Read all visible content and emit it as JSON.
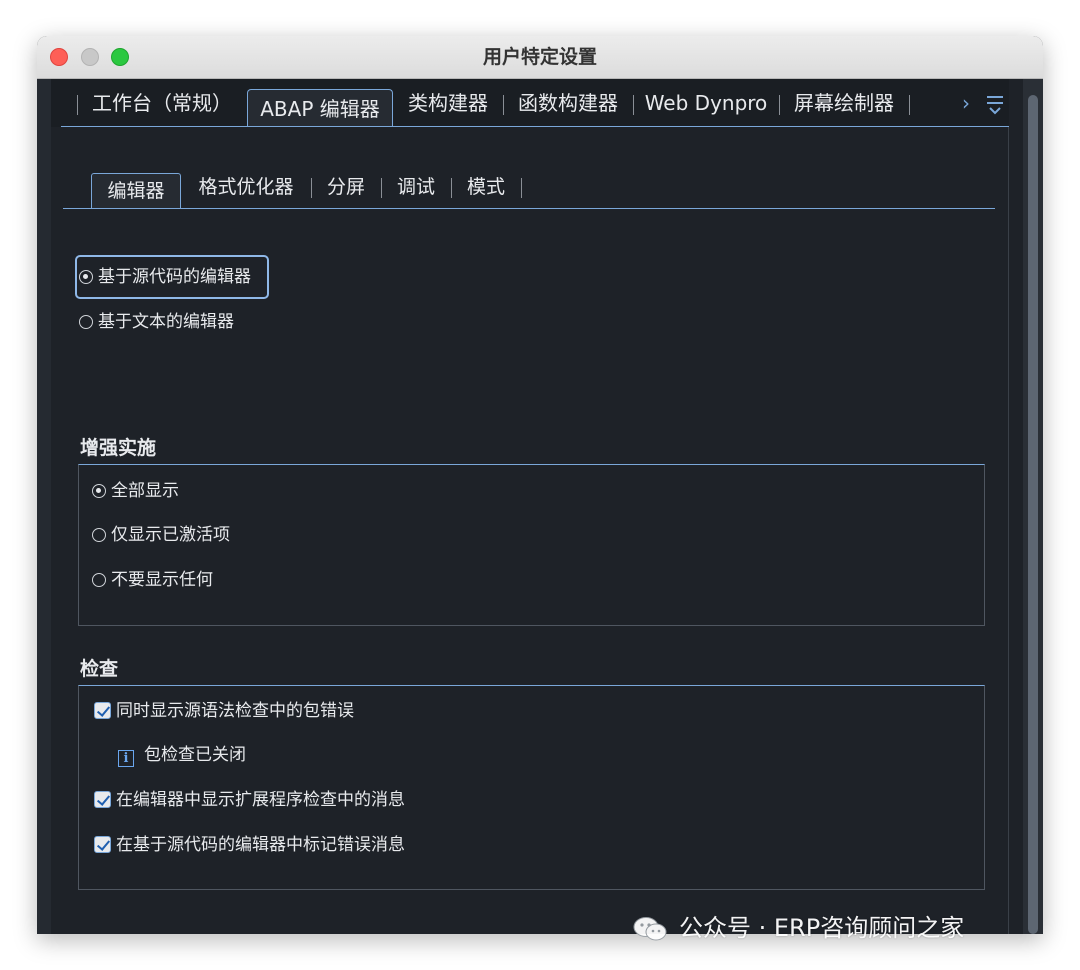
{
  "window": {
    "title": "用户特定设置"
  },
  "main_tabs": [
    {
      "label": "工作台（常规）",
      "active": false
    },
    {
      "label": "ABAP 编辑器",
      "active": true
    },
    {
      "label": "类构建器",
      "active": false
    },
    {
      "label": "函数构建器",
      "active": false
    },
    {
      "label": "Web Dynpro",
      "active": false
    },
    {
      "label": "屏幕绘制器",
      "active": false
    }
  ],
  "tab_nav": {
    "more_icon": "chevron-right-icon",
    "list_icon": "tab-list-icon"
  },
  "sub_tabs": [
    {
      "label": "编辑器",
      "active": true
    },
    {
      "label": "格式优化器",
      "active": false
    },
    {
      "label": "分屏",
      "active": false
    },
    {
      "label": "调试",
      "active": false
    },
    {
      "label": "模式",
      "active": false
    }
  ],
  "editor_type": {
    "options": [
      {
        "label": "基于源代码的编辑器",
        "selected": true
      },
      {
        "label": "基于文本的编辑器",
        "selected": false
      }
    ]
  },
  "enhancement": {
    "title": "增强实施",
    "options": [
      {
        "label": "全部显示",
        "selected": true
      },
      {
        "label": "仅显示已激活项",
        "selected": false
      },
      {
        "label": "不要显示任何",
        "selected": false
      }
    ]
  },
  "checks": {
    "title": "检查",
    "items": [
      {
        "label": "同时显示源语法检查中的包错误",
        "checked": true
      },
      {
        "label": "在编辑器中显示扩展程序检查中的消息",
        "checked": true
      },
      {
        "label": "在基于源代码的编辑器中标记错误消息",
        "checked": true
      }
    ],
    "info": "包检查已关闭"
  },
  "watermark": {
    "text": "公众号 · ERP咨询顾问之家"
  },
  "colors": {
    "accent": "#7aa7d9",
    "background": "#1e2228",
    "text": "#e8eaed"
  }
}
